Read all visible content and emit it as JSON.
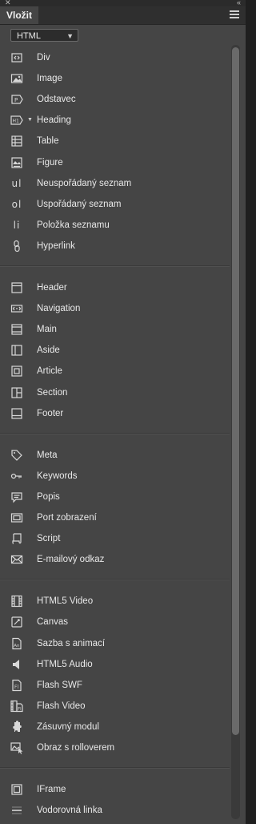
{
  "panel": {
    "tab_label": "Vložit"
  },
  "category_select": {
    "value": "HTML"
  },
  "groups": [
    {
      "items": [
        {
          "name": "div",
          "label": "Div",
          "icon": "div-icon"
        },
        {
          "name": "image",
          "label": "Image",
          "icon": "image-icon"
        },
        {
          "name": "odstavec",
          "label": "Odstavec",
          "icon": "paragraph-icon"
        },
        {
          "name": "heading",
          "label": "Heading",
          "icon": "heading-icon"
        },
        {
          "name": "table",
          "label": "Table",
          "icon": "table-icon"
        },
        {
          "name": "figure",
          "label": "Figure",
          "icon": "figure-icon"
        },
        {
          "name": "neusporadany-seznam",
          "label": "Neuspořádaný seznam",
          "icon": "unordered-list-icon"
        },
        {
          "name": "usporadany-seznam",
          "label": "Uspořádaný seznam",
          "icon": "ordered-list-icon"
        },
        {
          "name": "polozka-seznamu",
          "label": "Položka seznamu",
          "icon": "list-item-icon"
        },
        {
          "name": "hyperlink",
          "label": "Hyperlink",
          "icon": "hyperlink-icon"
        }
      ]
    },
    {
      "items": [
        {
          "name": "header",
          "label": "Header",
          "icon": "header-icon"
        },
        {
          "name": "navigation",
          "label": "Navigation",
          "icon": "navigation-icon"
        },
        {
          "name": "main",
          "label": "Main",
          "icon": "main-icon"
        },
        {
          "name": "aside",
          "label": "Aside",
          "icon": "aside-icon"
        },
        {
          "name": "article",
          "label": "Article",
          "icon": "article-icon"
        },
        {
          "name": "section",
          "label": "Section",
          "icon": "section-icon"
        },
        {
          "name": "footer",
          "label": "Footer",
          "icon": "footer-icon"
        }
      ]
    },
    {
      "items": [
        {
          "name": "meta",
          "label": "Meta",
          "icon": "tag-icon"
        },
        {
          "name": "keywords",
          "label": "Keywords",
          "icon": "key-icon"
        },
        {
          "name": "popis",
          "label": "Popis",
          "icon": "speech-bubble-icon"
        },
        {
          "name": "port-zobrazeni",
          "label": "Port zobrazení",
          "icon": "viewport-icon"
        },
        {
          "name": "script",
          "label": "Script",
          "icon": "script-scroll-icon"
        },
        {
          "name": "e-mailovy-odkaz",
          "label": "E-mailový odkaz",
          "icon": "envelope-icon"
        }
      ]
    },
    {
      "items": [
        {
          "name": "html5-video",
          "label": "HTML5 Video",
          "icon": "film-icon"
        },
        {
          "name": "canvas",
          "label": "Canvas",
          "icon": "canvas-icon"
        },
        {
          "name": "sazba-s-animaci",
          "label": "Sazba s animací",
          "icon": "animate-icon"
        },
        {
          "name": "html5-audio",
          "label": "HTML5 Audio",
          "icon": "speaker-icon"
        },
        {
          "name": "flash-swf",
          "label": "Flash SWF",
          "icon": "flash-icon"
        },
        {
          "name": "flash-video",
          "label": "Flash Video",
          "icon": "flash-video-icon"
        },
        {
          "name": "zasuvny-modul",
          "label": "Zásuvný modul",
          "icon": "puzzle-icon"
        },
        {
          "name": "obraz-s-rolloverem",
          "label": "Obraz s rolloverem",
          "icon": "rollover-image-icon"
        }
      ]
    },
    {
      "items": [
        {
          "name": "iframe",
          "label": "IFrame",
          "icon": "iframe-icon"
        },
        {
          "name": "vodorovna-linka",
          "label": "Vodorovná linka",
          "icon": "horizontal-rule-icon"
        }
      ]
    }
  ]
}
